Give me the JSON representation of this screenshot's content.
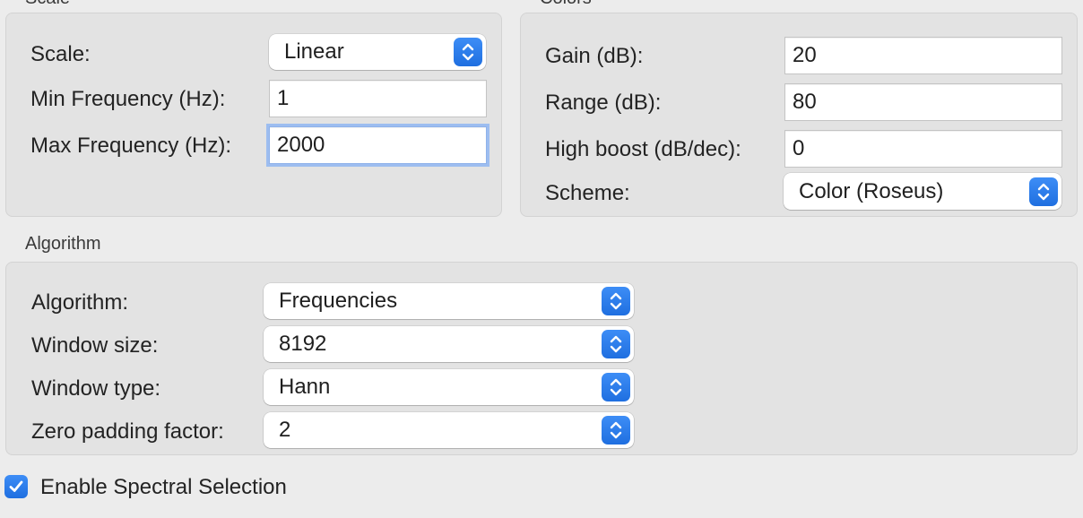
{
  "scale_group": {
    "title": "Scale",
    "scale_label": "Scale:",
    "scale_value": "Linear",
    "min_freq_label": "Min Frequency (Hz):",
    "min_freq_value": "1",
    "max_freq_label": "Max Frequency (Hz):",
    "max_freq_value": "2000"
  },
  "colors_group": {
    "title": "Colors",
    "gain_label": "Gain (dB):",
    "gain_value": "20",
    "range_label": "Range (dB):",
    "range_value": "80",
    "high_boost_label": "High boost (dB/dec):",
    "high_boost_value": "0",
    "scheme_label": "Scheme:",
    "scheme_value": "Color (Roseus)"
  },
  "algorithm_group": {
    "title": "Algorithm",
    "algorithm_label": "Algorithm:",
    "algorithm_value": "Frequencies",
    "window_size_label": "Window size:",
    "window_size_value": "8192",
    "window_type_label": "Window type:",
    "window_type_value": "Hann",
    "zero_padding_label": "Zero padding factor:",
    "zero_padding_value": "2"
  },
  "spectral_selection": {
    "label": "Enable Spectral Selection",
    "checked": true
  },
  "colors": {
    "accent": "#2a7bf0",
    "focus_ring": "#9dbdf0",
    "background": "#ececec",
    "group_fill": "#e3e3e3"
  },
  "icons": {
    "popup_arrows": "chevron-up-down-icon",
    "checkmark": "checkmark-icon"
  }
}
